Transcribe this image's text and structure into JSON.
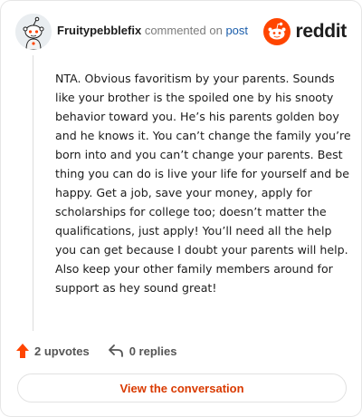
{
  "comment": {
    "username": "Fruitypebblefix",
    "action_text": "commented on",
    "post_link": "post",
    "body": "NTA. Obvious favoritism by your parents. Sounds like your brother is the spoiled one by his snooty behavior toward you. He’s his parents golden boy and he knows it. You can’t change the family you’re born into and you can’t change your parents. Best thing you can do is live your life for yourself and be happy. Get a job, save your money, apply for scholarships for college too; doesn’t matter the qualifications, just apply! You’ll need all the help you can get because I doubt your parents will help. Also keep your other family members around for support as hey sound great!"
  },
  "brand": {
    "wordmark": "reddit",
    "logo_icon": "reddit-snoo-icon",
    "accent_color": "#ff4500"
  },
  "actions": {
    "upvotes": "2 upvotes",
    "upvote_icon": "upvote-arrow-icon",
    "upvote_color": "#ff4500",
    "replies": "0 replies",
    "reply_icon": "reply-arrow-icon"
  },
  "footer": {
    "view_conversation": "View the conversation",
    "button_text_color": "#d93a00"
  }
}
